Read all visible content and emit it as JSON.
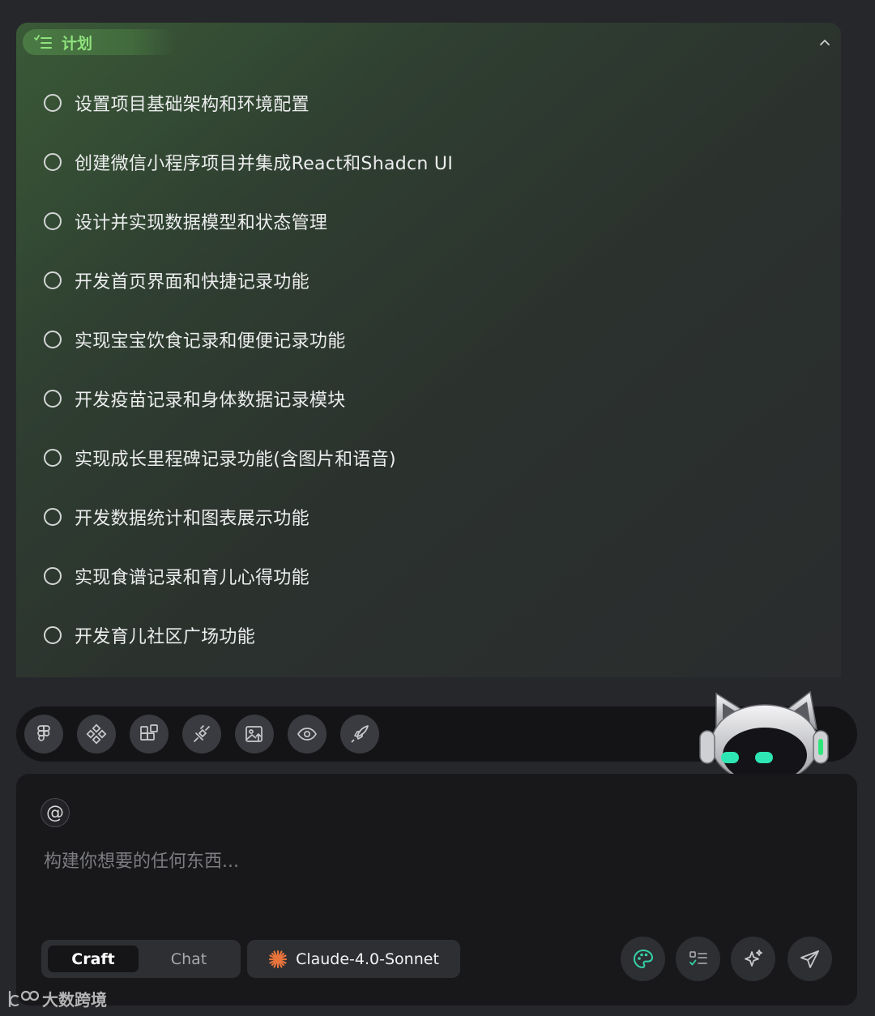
{
  "plan": {
    "title": "计划",
    "items": [
      {
        "label": "设置项目基础架构和环境配置",
        "done": false
      },
      {
        "label": "创建微信小程序项目并集成React和Shadcn UI",
        "done": false
      },
      {
        "label": "设计并实现数据模型和状态管理",
        "done": false
      },
      {
        "label": "开发首页界面和快捷记录功能",
        "done": false
      },
      {
        "label": "实现宝宝饮食记录和便便记录功能",
        "done": false
      },
      {
        "label": "开发疫苗记录和身体数据记录模块",
        "done": false
      },
      {
        "label": "实现成长里程碑记录功能(含图片和语音)",
        "done": false
      },
      {
        "label": "开发数据统计和图表展示功能",
        "done": false
      },
      {
        "label": "实现食谱记录和育儿心得功能",
        "done": false
      },
      {
        "label": "开发育儿社区广场功能",
        "done": false
      }
    ]
  },
  "toolbar": {
    "tools": [
      "figma-icon",
      "component-icon",
      "blocks-icon",
      "plug-icon",
      "image-upload-icon",
      "eye-icon",
      "rocket-icon"
    ]
  },
  "input": {
    "mention_symbol": "@",
    "placeholder": "构建你想要的任何东西..."
  },
  "mode": {
    "active": "Craft",
    "inactive": "Chat"
  },
  "model": {
    "label": "Claude-4.0-Sonnet"
  },
  "actions": [
    "palette-icon",
    "checklist-icon",
    "sparkle-icon",
    "send-icon"
  ],
  "watermark": {
    "text": "大数跨境"
  },
  "colors": {
    "accent_green": "#8fe37d",
    "palette_teal": "#34d3a8",
    "claude_orange": "#e8743b"
  }
}
